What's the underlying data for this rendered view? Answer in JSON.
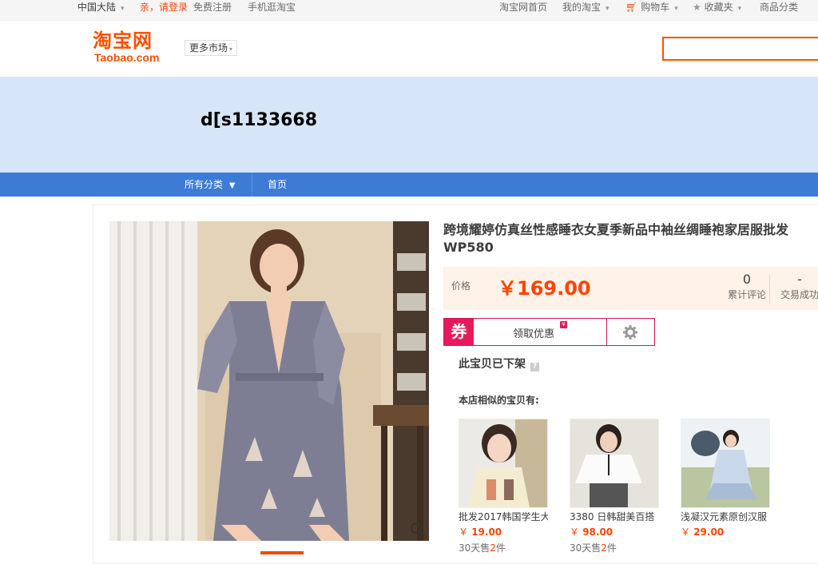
{
  "topbar": {
    "region": "中国大陆",
    "login": "亲，请登录",
    "register": "免费注册",
    "mobile": "手机逛淘宝",
    "home": "淘宝网首页",
    "my_taobao": "我的淘宝",
    "cart": "购物车",
    "favorites": "收藏夹",
    "categories": "商品分类"
  },
  "header": {
    "logo_cn": "淘宝网",
    "logo_en": "Taobao.com",
    "more_market": "更多市场",
    "search_value": ""
  },
  "banner": {
    "shop_name": "d[s1133668"
  },
  "nav": {
    "all_categories": "所有分类",
    "home": "首页"
  },
  "product": {
    "title": "跨境耀婷仿真丝性感睡衣女夏季新品中袖丝绸睡袍家居服批发WP580",
    "price_label": "价格",
    "price": "￥169.00",
    "reviews_count": "0",
    "reviews_label": "累计评论",
    "sales_count": "-",
    "sales_label": "交易成功",
    "coupon_badge": "券",
    "coupon_text": "领取优惠",
    "offline_notice": "此宝贝已下架",
    "similar_title": "本店相似的宝贝有:"
  },
  "similar": [
    {
      "name": "批发2017韩国学生大",
      "price": "19.00",
      "sold_prefix": "30天售",
      "sold_count": "2",
      "sold_suffix": "件"
    },
    {
      "name": "3380 日韩甜美百搭",
      "price": "98.00",
      "sold_prefix": "30天售",
      "sold_count": "2",
      "sold_suffix": "件"
    },
    {
      "name": "浅凝汉元素原创汉服",
      "price": "29.00",
      "sold_prefix": "",
      "sold_count": "",
      "sold_suffix": ""
    }
  ],
  "currency": "￥",
  "colors": {
    "accent": "#ff5000",
    "nav": "#3d7bd4",
    "banner": "#d6e5f7",
    "coupon": "#e61a5b"
  }
}
